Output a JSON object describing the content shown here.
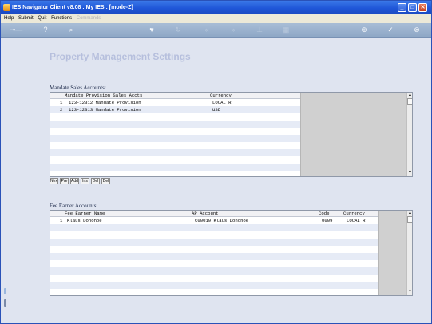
{
  "window": {
    "title": "IES Navigator Client v8.08 : My IES :      [mode-Z]"
  },
  "menu": {
    "items": [
      "Help",
      "Submit",
      "Quit",
      "Functions",
      "Commands"
    ]
  },
  "page": {
    "title": "Property Management Settings"
  },
  "mandate": {
    "label": "Mandate Sales Accounts:",
    "headers": [
      "Mandate Provision Sales Accts",
      "Currency"
    ],
    "rows": [
      {
        "num": "1",
        "account": "123-12312 Mandate Provision",
        "currency": "LOCAL R"
      },
      {
        "num": "2",
        "account": "123-12313 Mandate Provision",
        "currency": "USD"
      }
    ],
    "buttons": [
      "Nex",
      "Pre",
      "Add",
      "Ins",
      "Del",
      "Del"
    ]
  },
  "fee": {
    "label": "Fee Earner Accounts:",
    "headers": [
      "Fee Earner Name",
      "AP Account",
      "Code",
      "Currency"
    ],
    "rows": [
      {
        "num": "1",
        "name": "Klaus Donohoe",
        "ap": "C00019 Klaus Donohoe",
        "code": "0009",
        "currency": "LOCAL R"
      }
    ]
  },
  "colors": {
    "titlebar": "#1f56d8",
    "page_title": "#b6bfdd",
    "row_alt": "#e6ebf6"
  }
}
